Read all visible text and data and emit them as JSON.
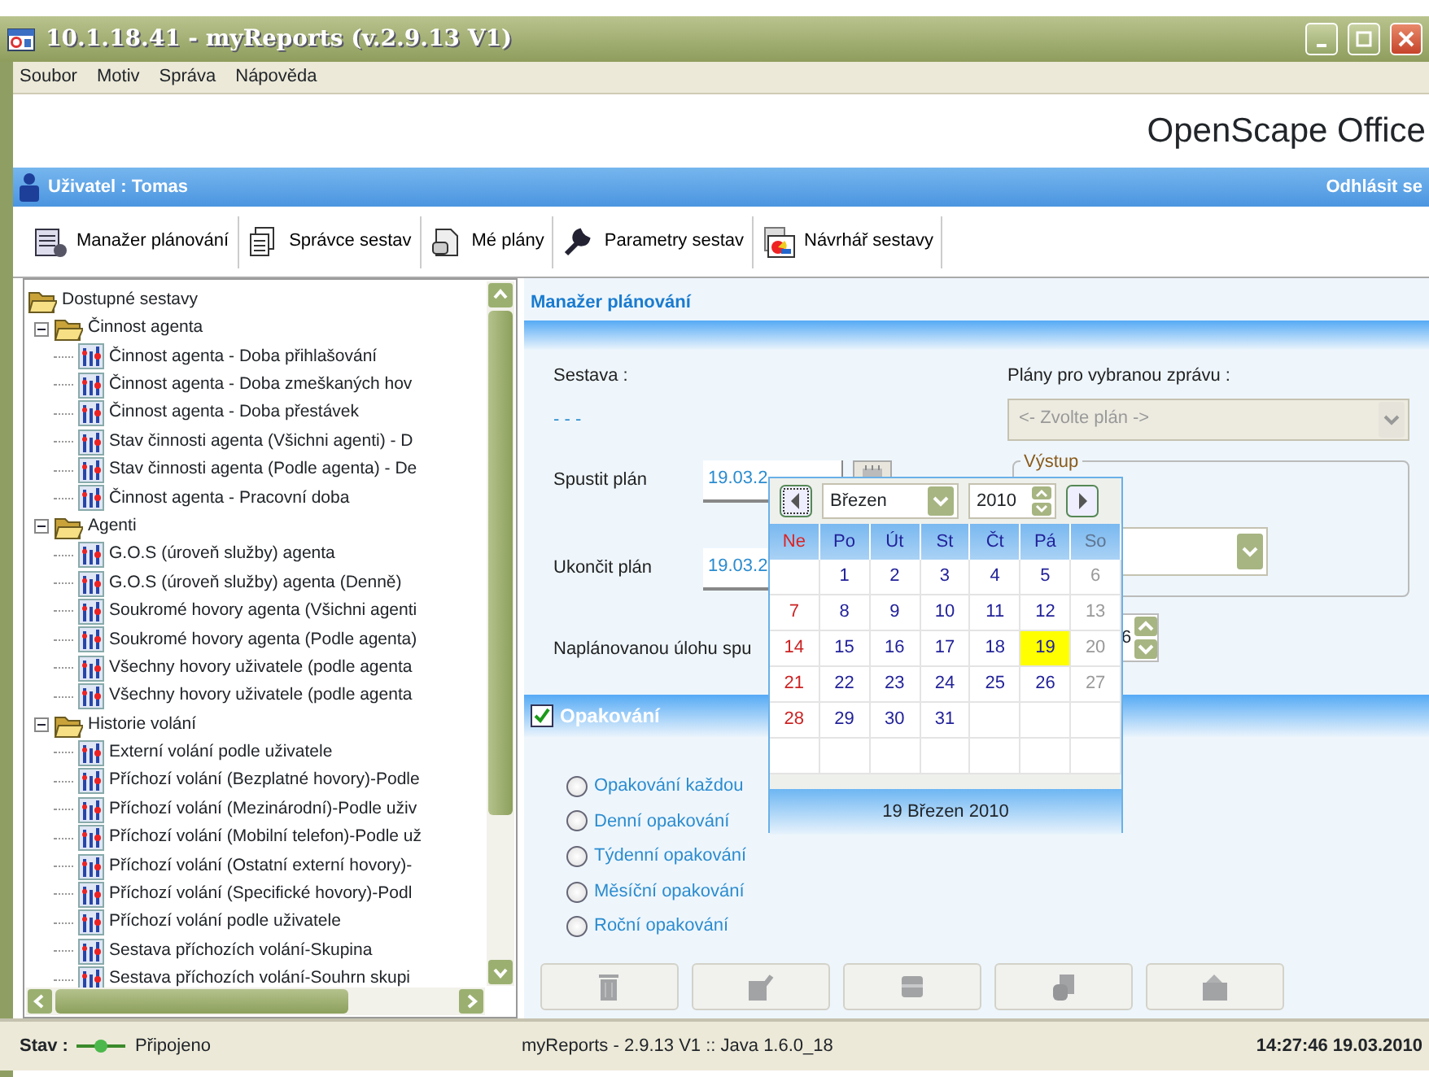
{
  "window": {
    "title": "10.1.18.41 - myReports (v.2.9.13 V1)"
  },
  "menu": [
    "Soubor",
    "Motiv",
    "Správa",
    "Nápověda"
  ],
  "brand": "OpenScape Office",
  "user_bar": {
    "user": "Uživatel : Tomas",
    "logout": "Odhlásit se"
  },
  "toolbar": [
    {
      "kind": "scheduler",
      "label": "Manažer plánování"
    },
    {
      "kind": "reports",
      "label": "Správce sestav"
    },
    {
      "kind": "plans",
      "label": "Mé plány"
    },
    {
      "kind": "settings",
      "label": "Parametry sestav"
    },
    {
      "kind": "designer",
      "label": "Návrhář sestavy"
    }
  ],
  "tree": {
    "label": "Dostupné sestavy",
    "children": [
      {
        "label": "Činnost agenta",
        "expanded": true,
        "children": [
          {
            "label": "Činnost agenta - Doba přihlašování"
          },
          {
            "label": "Činnost agenta - Doba zmeškaných hov"
          },
          {
            "label": "Činnost agenta - Doba přestávek"
          },
          {
            "label": "Stav činnosti agenta (Všichni agenti) - D"
          },
          {
            "label": "Stav činnosti agenta (Podle agenta) - De"
          },
          {
            "label": "Činnost agenta - Pracovní doba"
          }
        ]
      },
      {
        "label": "Agenti",
        "expanded": true,
        "children": [
          {
            "label": "G.O.S (úroveň služby) agenta"
          },
          {
            "label": "G.O.S (úroveň služby) agenta (Denně)"
          },
          {
            "label": "Soukromé hovory agenta (Všichni agenti"
          },
          {
            "label": "Soukromé hovory agenta (Podle agenta)"
          },
          {
            "label": "Všechny hovory uživatele (podle agenta"
          },
          {
            "label": "Všechny hovory uživatele (podle agenta"
          }
        ]
      },
      {
        "label": "Historie volání",
        "expanded": true,
        "children": [
          {
            "label": "Externí volání podle uživatele"
          },
          {
            "label": "Příchozí volání (Bezplatné hovory)-Podle"
          },
          {
            "label": "Příchozí volání (Mezinárodní)-Podle uživ"
          },
          {
            "label": "Příchozí volání (Mobilní telefon)-Podle už"
          },
          {
            "label": "Příchozí volání (Ostatní externí hovory)-"
          },
          {
            "label": "Příchozí volání (Specifické hovory)-Podl"
          },
          {
            "label": "Příchozí volání podle uživatele"
          },
          {
            "label": "Sestava příchozích volání-Skupina"
          },
          {
            "label": "Sestava příchozích volání-Souhrn skupi"
          }
        ]
      }
    ]
  },
  "panel": {
    "title": "Manažer plánování",
    "report_label": "Sestava :",
    "report_value": "- - -",
    "plans_label": "Plány pro vybranou zprávu :",
    "plans_placeholder": "<- Zvolte plán ->",
    "plans_disabled": true,
    "start_label": "Spustit plán",
    "start_value": "19.03.2",
    "end_label": "Ukončit plán",
    "end_value": "19.03.2",
    "output_legend": "Výstup",
    "run_label": "Naplánovanou úlohu spu",
    "run_value": "6",
    "repeat": {
      "label": "Opakování",
      "checked": true
    },
    "repeat_options": [
      {
        "label": "Opakování každou",
        "selected": false
      },
      {
        "label": "Denní opakování",
        "selected": false
      },
      {
        "label": "Týdenní opakování",
        "selected": false
      },
      {
        "label": "Měsíční opakování",
        "selected": false
      },
      {
        "label": "Roční opakování",
        "selected": false
      }
    ],
    "actions": [
      {
        "kind": "delete",
        "disabled": true
      },
      {
        "kind": "edit",
        "disabled": true
      },
      {
        "kind": "save",
        "disabled": true
      },
      {
        "kind": "copy",
        "disabled": true
      },
      {
        "kind": "send",
        "disabled": true
      }
    ]
  },
  "calendar": {
    "month": "Březen",
    "year": "2010",
    "weekdays": [
      "Ne",
      "Po",
      "Út",
      "St",
      "Čt",
      "Pá",
      "So"
    ],
    "weeks": [
      [
        {
          "kind": "blank"
        },
        {
          "kind": "day",
          "label": "1",
          "selected": false
        },
        {
          "kind": "day",
          "label": "2",
          "selected": false
        },
        {
          "kind": "day",
          "label": "3",
          "selected": false
        },
        {
          "kind": "day",
          "label": "4",
          "selected": false
        },
        {
          "kind": "day",
          "label": "5",
          "selected": false
        },
        {
          "kind": "day",
          "label": "6",
          "selected": false
        }
      ],
      [
        {
          "kind": "day",
          "label": "7",
          "selected": false
        },
        {
          "kind": "day",
          "label": "8",
          "selected": false
        },
        {
          "kind": "day",
          "label": "9",
          "selected": false
        },
        {
          "kind": "day",
          "label": "10",
          "selected": false
        },
        {
          "kind": "day",
          "label": "11",
          "selected": false
        },
        {
          "kind": "day",
          "label": "12",
          "selected": false
        },
        {
          "kind": "day",
          "label": "13",
          "selected": false
        }
      ],
      [
        {
          "kind": "day",
          "label": "14",
          "selected": false
        },
        {
          "kind": "day",
          "label": "15",
          "selected": false
        },
        {
          "kind": "day",
          "label": "16",
          "selected": false
        },
        {
          "kind": "day",
          "label": "17",
          "selected": false
        },
        {
          "kind": "day",
          "label": "18",
          "selected": false
        },
        {
          "kind": "day",
          "label": "19",
          "selected": true
        },
        {
          "kind": "day",
          "label": "20",
          "selected": false
        }
      ],
      [
        {
          "kind": "day",
          "label": "21",
          "selected": false
        },
        {
          "kind": "day",
          "label": "22",
          "selected": false
        },
        {
          "kind": "day",
          "label": "23",
          "selected": false
        },
        {
          "kind": "day",
          "label": "24",
          "selected": false
        },
        {
          "kind": "day",
          "label": "25",
          "selected": false
        },
        {
          "kind": "day",
          "label": "26",
          "selected": false
        },
        {
          "kind": "day",
          "label": "27",
          "selected": false
        }
      ],
      [
        {
          "kind": "day",
          "label": "28",
          "selected": false
        },
        {
          "kind": "day",
          "label": "29",
          "selected": false
        },
        {
          "kind": "day",
          "label": "30",
          "selected": false
        },
        {
          "kind": "day",
          "label": "31",
          "selected": false
        },
        {
          "kind": "blank"
        },
        {
          "kind": "blank"
        },
        {
          "kind": "blank"
        }
      ],
      [
        {
          "kind": "blank"
        },
        {
          "kind": "blank"
        },
        {
          "kind": "blank"
        },
        {
          "kind": "blank"
        },
        {
          "kind": "blank"
        },
        {
          "kind": "blank"
        },
        {
          "kind": "blank"
        }
      ]
    ],
    "footer": "19 Březen 2010"
  },
  "status_bar": {
    "label": "Stav :",
    "connection": "Připojeno",
    "version": "myReports - 2.9.13 V1 :: Java 1.6.0_18",
    "clock": "14:27:46 19.03.2010"
  }
}
